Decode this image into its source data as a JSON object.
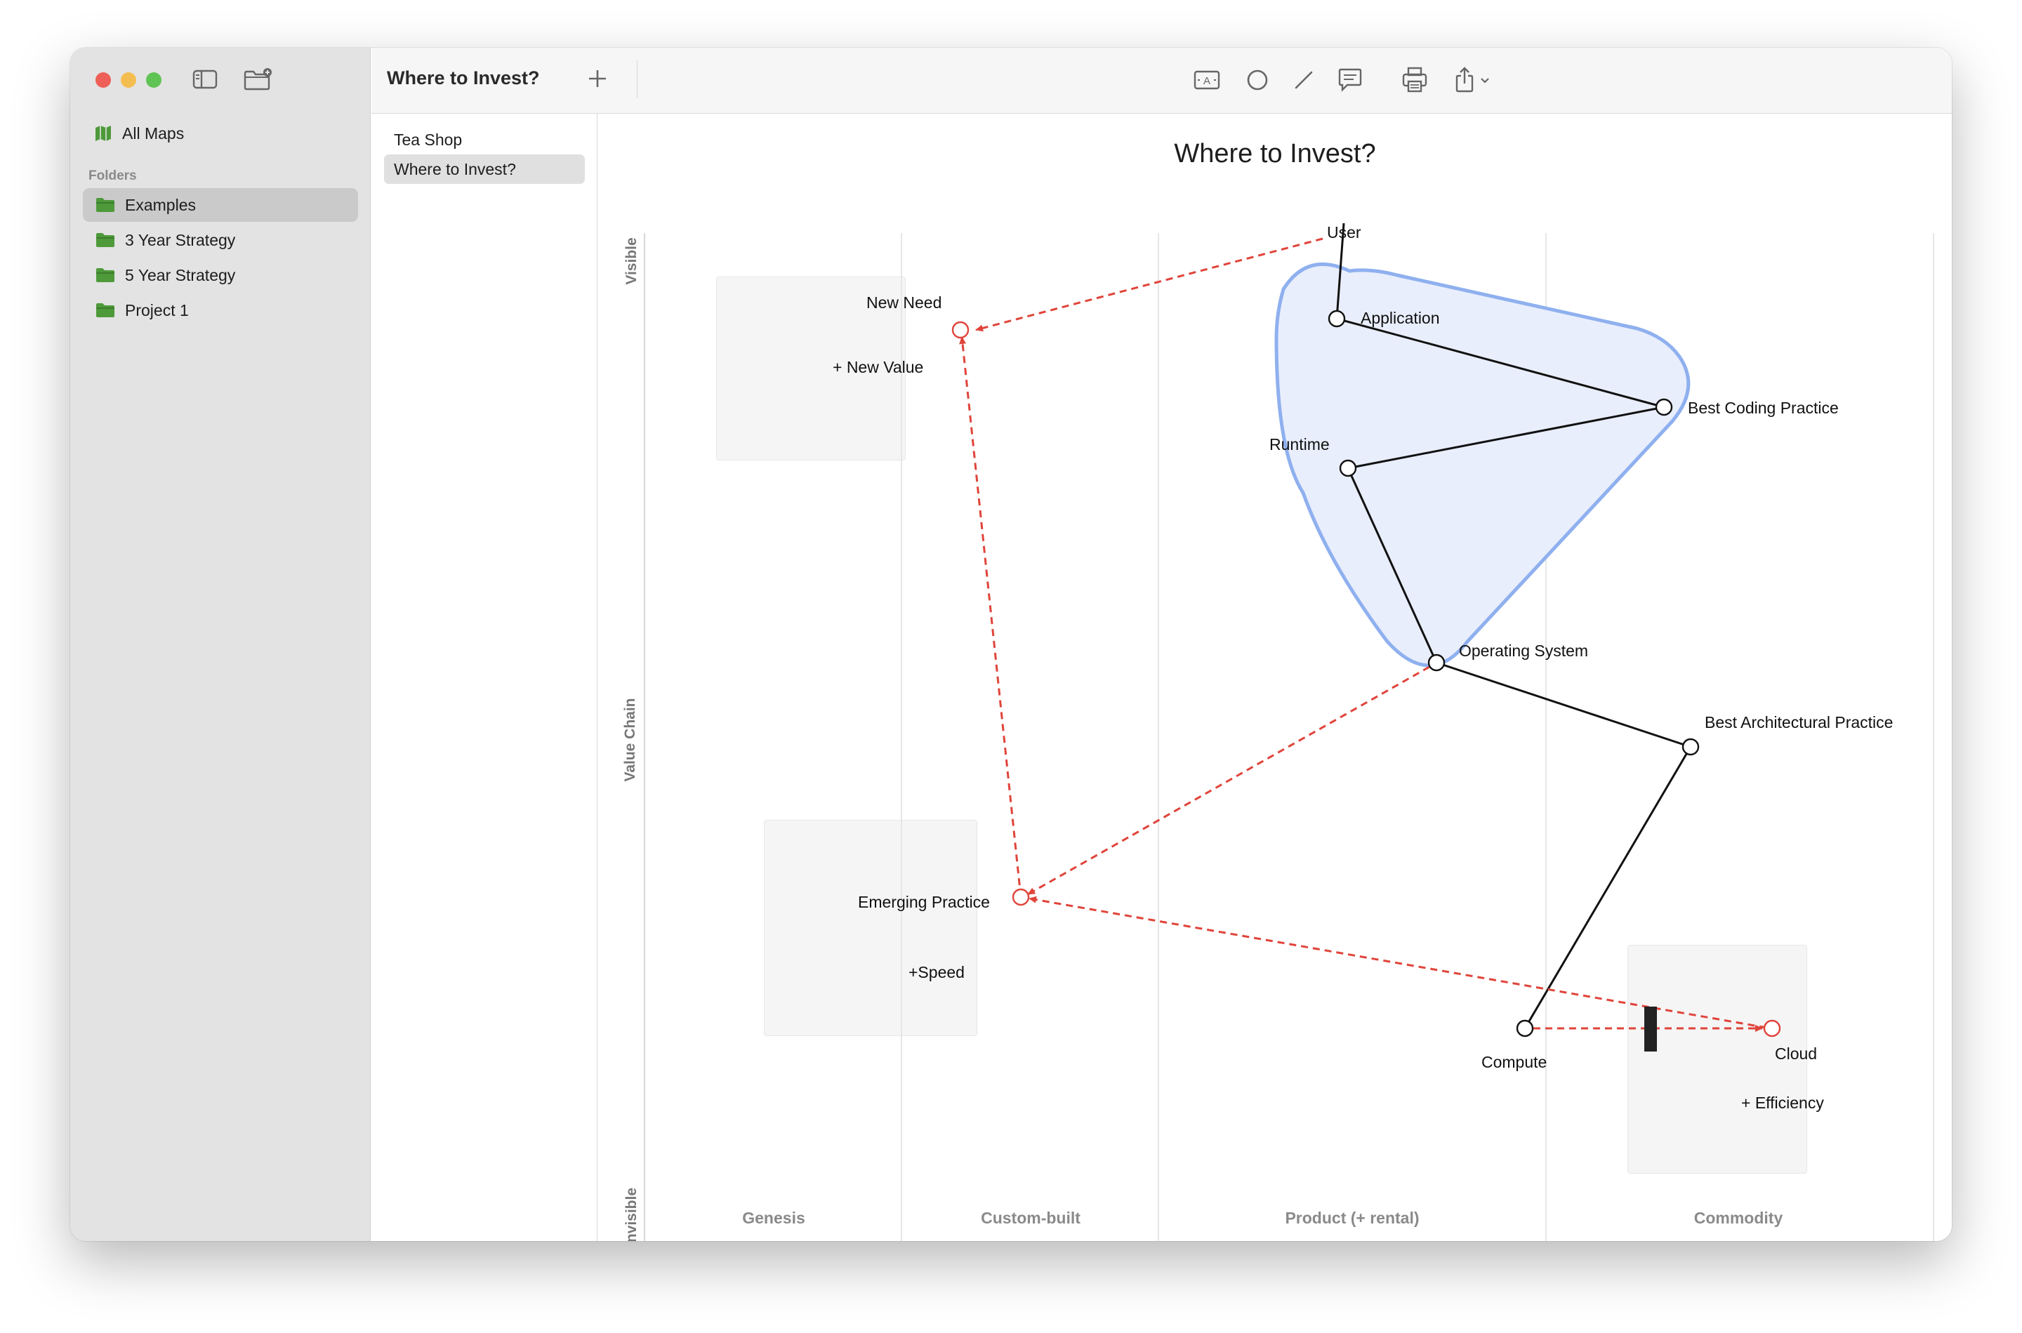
{
  "sidebar": {
    "all_maps": "All Maps",
    "folders_header": "Folders",
    "folders": [
      "Examples",
      "3 Year Strategy",
      "5 Year Strategy",
      "Project 1"
    ],
    "selected_folder": "Examples"
  },
  "maps": {
    "items": [
      "Tea Shop",
      "Where to Invest?"
    ],
    "selected": "Where to Invest?"
  },
  "toolbar": {
    "title": "Where to Invest?",
    "buttons": [
      "text-box-icon",
      "circle-icon",
      "line-icon",
      "comment-icon",
      "print-icon",
      "share-icon"
    ]
  },
  "map": {
    "title": "Where to Invest?",
    "y_axis": {
      "label": "Value Chain",
      "top": "Visible",
      "bottom": "Invisible"
    },
    "x_axis": [
      "Genesis",
      "Custom-built",
      "Product (+ rental)",
      "Commodity"
    ],
    "components": {
      "user": "User",
      "application": "Application",
      "best_coding_practice": "Best Coding Practice",
      "runtime": "Runtime",
      "operating_system": "Operating System",
      "best_architectural_practice": "Best Architectural Practice",
      "compute": "Compute",
      "new_need": "New Need",
      "emerging_practice": "Emerging Practice",
      "cloud": "Cloud"
    },
    "notes": {
      "new_value": "+ New Value",
      "speed": "+Speed",
      "efficiency": "+ Efficiency"
    },
    "colors": {
      "link": "#111111",
      "evolution_arrow": "#e0443a",
      "pipeline_fill": "#e8eefc",
      "pipeline_stroke": "#8fb0ef",
      "note_bg": "#f5f5f5",
      "folder_icon": "#4e9a3a"
    }
  }
}
